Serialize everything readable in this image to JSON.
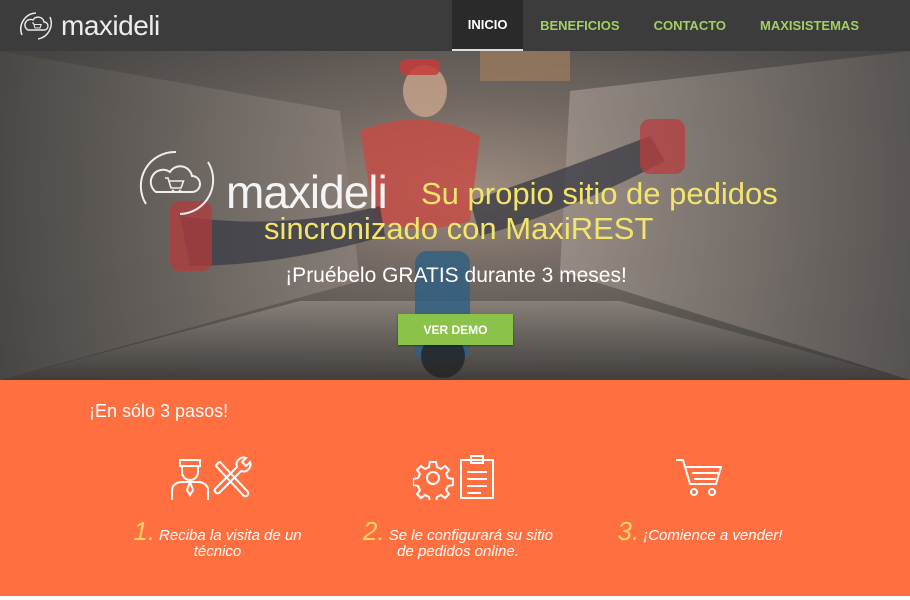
{
  "brand": {
    "name": "maxideli",
    "logo_icon": "cloud-cart-icon"
  },
  "nav": {
    "items": [
      {
        "label": "INICIO",
        "active": true
      },
      {
        "label": "BENEFICIOS",
        "active": false
      },
      {
        "label": "CONTACTO",
        "active": false
      },
      {
        "label": "MAXISISTEMAS",
        "active": false
      }
    ]
  },
  "hero": {
    "brand": "maxideli",
    "headline_line1": "Su propio sitio de pedidos",
    "headline_line2": "sincronizado con MaxiREST",
    "subheadline": "¡Pruébelo GRATIS durante 3 meses!",
    "cta_label": "VER DEMO"
  },
  "steps": {
    "title": "¡En sólo 3 pasos!",
    "items": [
      {
        "number": "1.",
        "text_line1": "Reciba la visita de un",
        "text_line2": "técnico",
        "icon": "technician-tools-icon"
      },
      {
        "number": "2.",
        "text_line1": "Se le configurará su sitio",
        "text_line2": "de pedidos online.",
        "icon": "gear-clipboard-icon"
      },
      {
        "number": "3.",
        "text_line1": "¡Comience a vender!",
        "text_line2": "",
        "icon": "shopping-cart-icon"
      }
    ]
  },
  "colors": {
    "navbar": "#3c3c3c",
    "nav_link": "#a3cf62",
    "headline": "#f3e56c",
    "cta": "#8bc34a",
    "steps_bg": "#ff6f3f",
    "step_number": "#ffd166"
  }
}
